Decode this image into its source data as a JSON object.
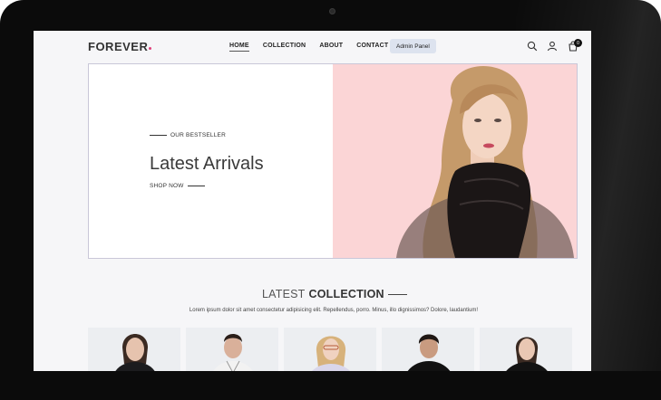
{
  "nav": {
    "logo": "FOREVER",
    "items": [
      {
        "label": "HOME",
        "active": true
      },
      {
        "label": "COLLECTION",
        "active": false
      },
      {
        "label": "ABOUT",
        "active": false
      },
      {
        "label": "CONTACT",
        "active": false
      }
    ],
    "admin_label": "Admin Panel",
    "cart_count": "0",
    "icons": [
      "search-icon",
      "profile-icon",
      "cart-icon"
    ]
  },
  "hero": {
    "tag": "OUR BESTSELLER",
    "title": "Latest Arrivals",
    "cta": "SHOP NOW"
  },
  "collection": {
    "title_light": "LATEST",
    "title_bold": "COLLECTION",
    "description": "Lorem ipsum dolor sit amet consectetur adipisicing elit. Repellendus, porro. Minus, illo dignissimos? Dolore, laudantium!"
  },
  "colors": {
    "accent": "#e0407a",
    "hero_bg": "#fbd5d6",
    "admin_bg": "#dde3ef"
  }
}
